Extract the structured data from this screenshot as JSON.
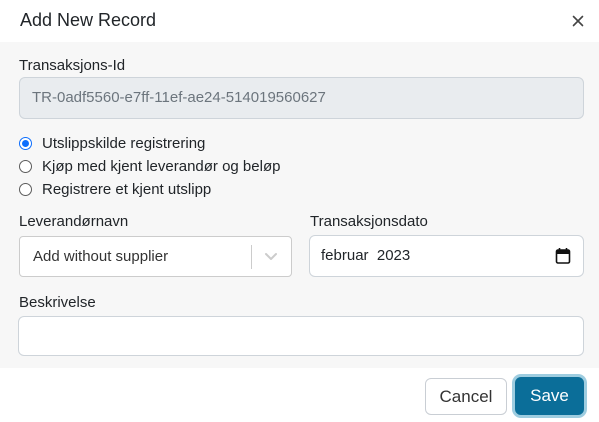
{
  "dialog": {
    "title": "Add New Record"
  },
  "transaction_id": {
    "label": "Transaksjons-Id",
    "value": "TR-0adf5560-e7ff-11ef-ae24-514019560627"
  },
  "record_type": {
    "options": [
      {
        "label": "Utslippskilde registrering",
        "checked": true
      },
      {
        "label": "Kjøp med kjent leverandør og beløp",
        "checked": false
      },
      {
        "label": "Registrere et kjent utslipp",
        "checked": false
      }
    ]
  },
  "supplier": {
    "label": "Leverandørnavn",
    "selected": "Add without supplier"
  },
  "transaction_date": {
    "label": "Transaksjonsdato",
    "value": "februar  2023"
  },
  "description": {
    "label": "Beskrivelse",
    "value": ""
  },
  "footer": {
    "cancel_label": "Cancel",
    "save_label": "Save"
  },
  "colors": {
    "accent": "#0b6e99",
    "radio_checked": "#0d6efd",
    "readonly_bg": "#e9ecef",
    "body_bg": "#f7f7f7"
  },
  "icons": {
    "close": "close-icon",
    "select": "chevron-down-icon",
    "date": "calendar-icon"
  }
}
